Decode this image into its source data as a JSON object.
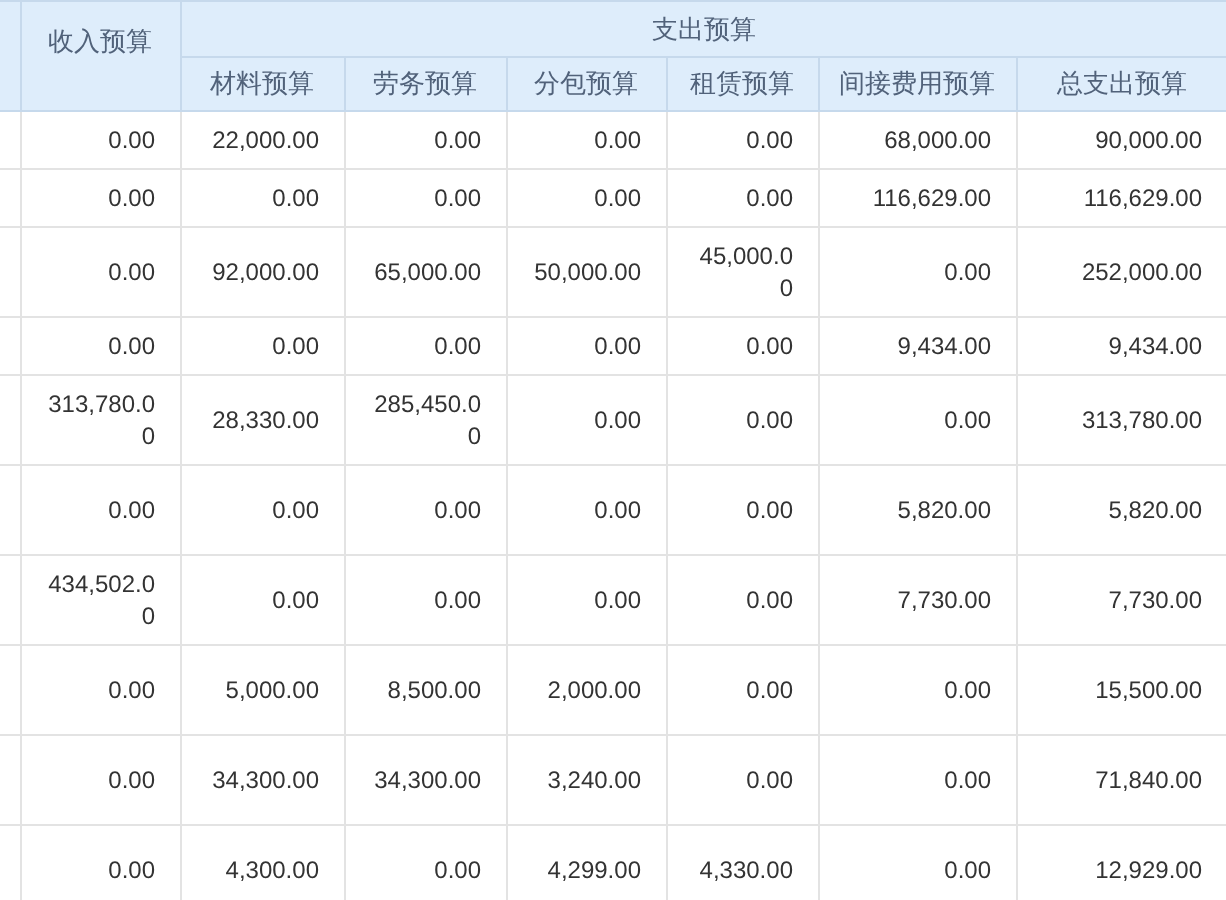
{
  "header": {
    "income": "收入预算",
    "expense_group": "支出预算",
    "expense_columns": [
      "材料预算",
      "劳务预算",
      "分包预算",
      "租赁预算",
      "间接费用预算",
      "总支出预算"
    ]
  },
  "rows": [
    [
      "0.00",
      "22,000.00",
      "0.00",
      "0.00",
      "0.00",
      "68,000.00",
      "90,000.00"
    ],
    [
      "0.00",
      "0.00",
      "0.00",
      "0.00",
      "0.00",
      "116,629.00",
      "116,629.00"
    ],
    [
      "0.00",
      "92,000.00",
      "65,000.00",
      "50,000.00",
      "45,000.00",
      "0.00",
      "252,000.00"
    ],
    [
      "0.00",
      "0.00",
      "0.00",
      "0.00",
      "0.00",
      "9,434.00",
      "9,434.00"
    ],
    [
      "313,780.00",
      "28,330.00",
      "285,450.00",
      "0.00",
      "0.00",
      "0.00",
      "313,780.00"
    ],
    [
      "0.00",
      "0.00",
      "0.00",
      "0.00",
      "0.00",
      "5,820.00",
      "5,820.00"
    ],
    [
      "434,502.00",
      "0.00",
      "0.00",
      "0.00",
      "0.00",
      "7,730.00",
      "7,730.00"
    ],
    [
      "0.00",
      "5,000.00",
      "8,500.00",
      "2,000.00",
      "0.00",
      "0.00",
      "15,500.00"
    ],
    [
      "0.00",
      "34,300.00",
      "34,300.00",
      "3,240.00",
      "0.00",
      "0.00",
      "71,840.00"
    ],
    [
      "0.00",
      "4,300.00",
      "0.00",
      "4,299.00",
      "4,330.00",
      "0.00",
      "12,929.00"
    ]
  ]
}
